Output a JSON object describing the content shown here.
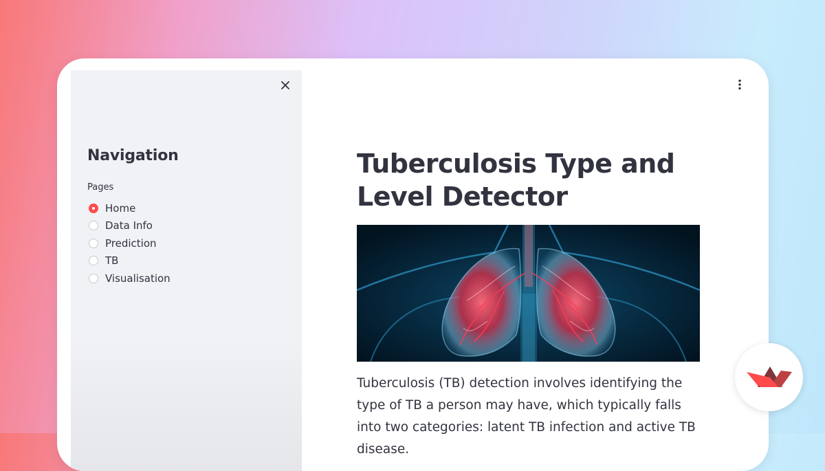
{
  "sidebar": {
    "title": "Navigation",
    "radio_group_label": "Pages",
    "selected_page": "Home",
    "pages": [
      {
        "label": "Home",
        "checked": true
      },
      {
        "label": "Data Info",
        "checked": false
      },
      {
        "label": "Prediction",
        "checked": false
      },
      {
        "label": "TB",
        "checked": false
      },
      {
        "label": "Visualisation",
        "checked": false
      }
    ]
  },
  "main": {
    "title": "Tuberculosis Type and Level Detector",
    "intro": "Tuberculosis (TB) detection involves identifying the type of TB a person may have, which typically falls into two categories: latent TB infection and active TB disease."
  },
  "colors": {
    "accent": "#ff4b4b",
    "text": "#31333f",
    "sidebar_bg": "#f0f2f6"
  },
  "icons": {
    "close": "close-icon",
    "menu": "vertical-dots-menu-icon",
    "brand": "streamlit-logo-icon"
  }
}
